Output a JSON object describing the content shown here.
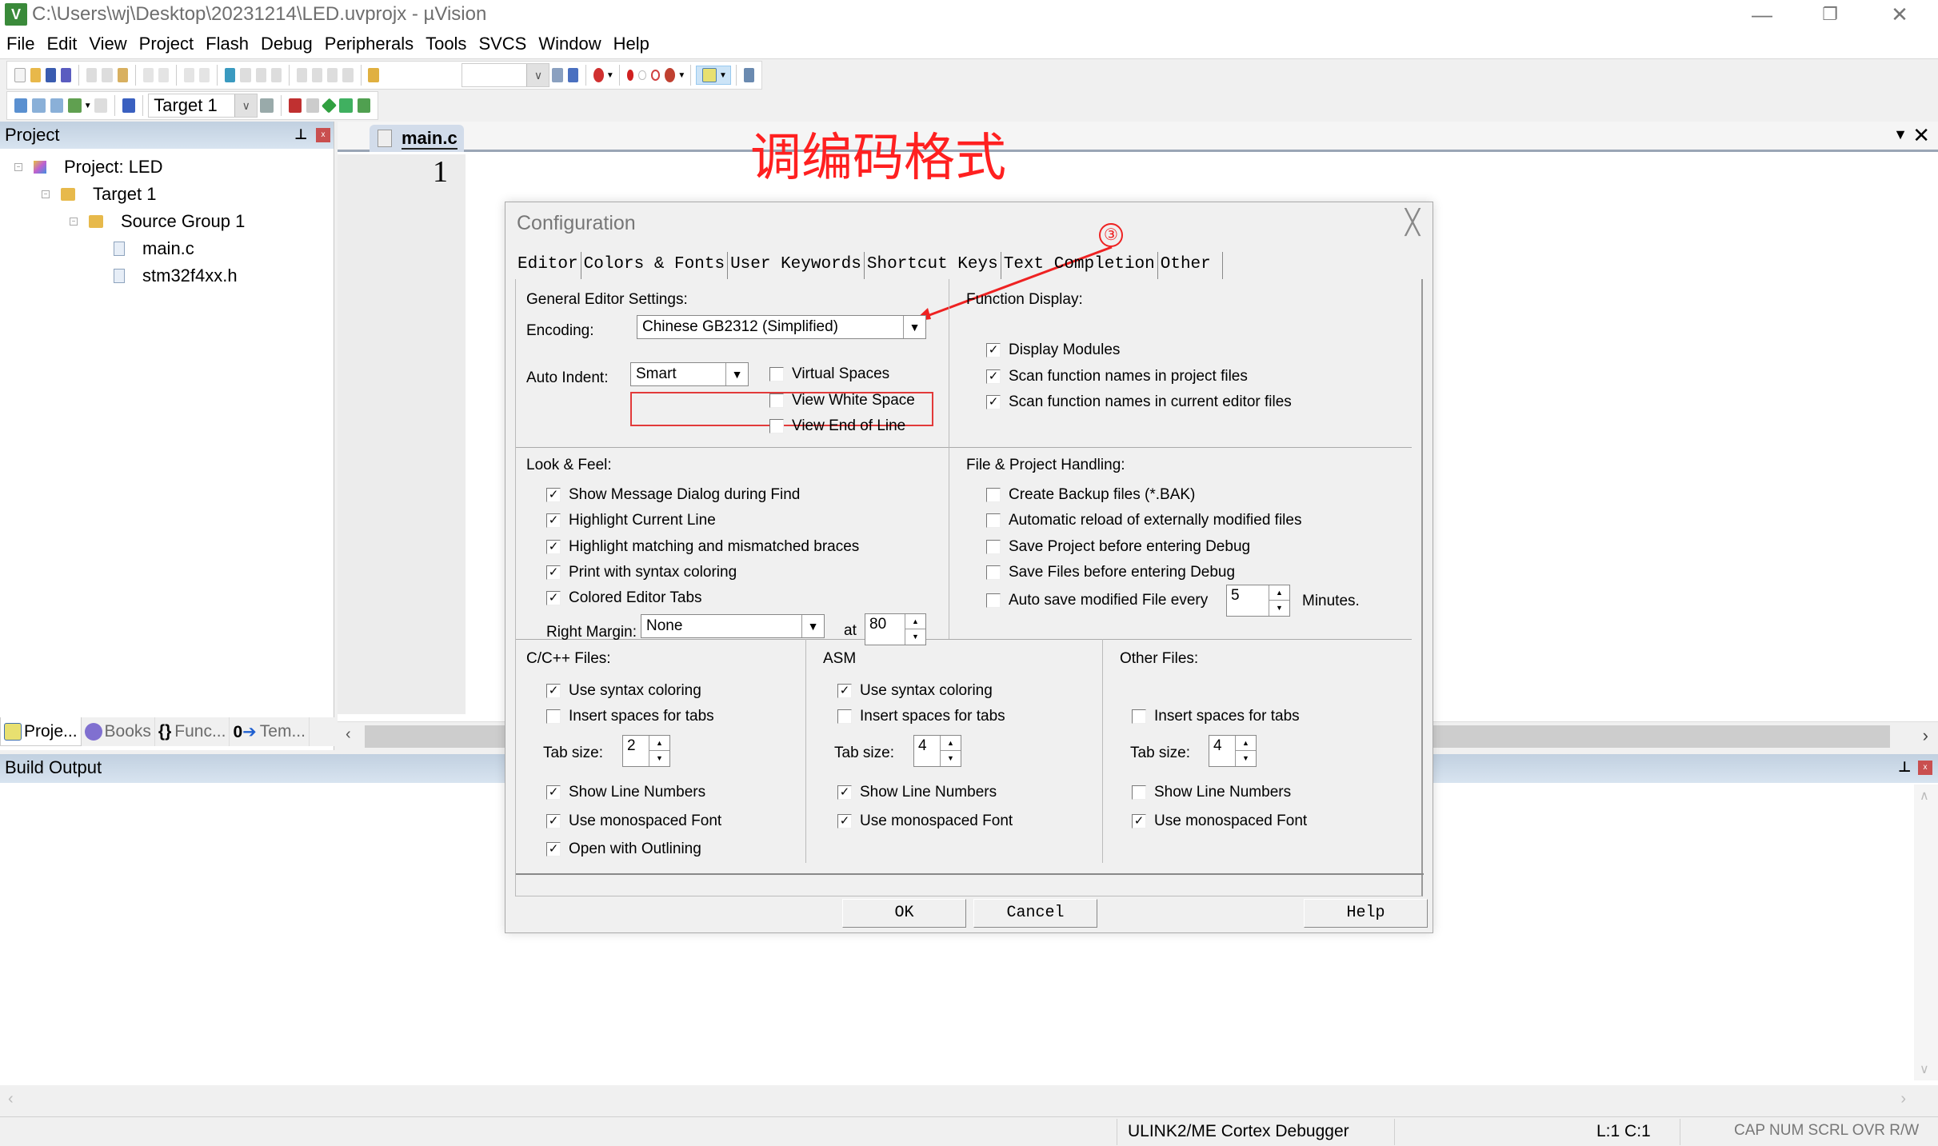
{
  "window": {
    "title": "C:\\Users\\wj\\Desktop\\20231214\\LED.uvprojx - µVision",
    "app_icon": "uvision-logo-icon",
    "controls": {
      "minimize": "—",
      "restore": "❐",
      "close": "✕"
    }
  },
  "menu": [
    "File",
    "Edit",
    "View",
    "Project",
    "Flash",
    "Debug",
    "Peripherals",
    "Tools",
    "SVCS",
    "Window",
    "Help"
  ],
  "toolbar2": {
    "target_select": "Target 1"
  },
  "project_panel": {
    "title": "Project",
    "tree": [
      {
        "label": "Project: LED",
        "level": 0,
        "icon": "project-icon"
      },
      {
        "label": "Target 1",
        "level": 1,
        "icon": "target-folder-icon"
      },
      {
        "label": "Source Group 1",
        "level": 2,
        "icon": "folder-icon"
      },
      {
        "label": "main.c",
        "level": 3,
        "icon": "file-icon"
      },
      {
        "label": "stm32f4xx.h",
        "level": 3,
        "icon": "file-icon"
      }
    ],
    "tabs": [
      "Proje...",
      "Books",
      "Func...",
      "Tem..."
    ]
  },
  "editor": {
    "tab": "main.c",
    "line_numbers": [
      "1"
    ]
  },
  "annotation": {
    "text": "调编码格式",
    "step_marker": "③",
    "color": "#ff2020"
  },
  "dialog": {
    "title": "Configuration",
    "tabs": [
      "Editor",
      "Colors & Fonts",
      "User Keywords",
      "Shortcut Keys",
      "Text Completion",
      "Other"
    ],
    "active_tab": "Editor",
    "general": {
      "heading": "General Editor Settings:",
      "encoding_label": "Encoding:",
      "encoding_value": "Chinese GB2312 (Simplified)",
      "auto_indent_label": "Auto Indent:",
      "auto_indent_value": "Smart",
      "checks": [
        {
          "label": "Virtual Spaces",
          "checked": false
        },
        {
          "label": "View White Space",
          "checked": false
        },
        {
          "label": "View End of Line",
          "checked": false
        }
      ]
    },
    "function_display": {
      "heading": "Function Display:",
      "checks": [
        {
          "label": "Display Modules",
          "checked": true
        },
        {
          "label": "Scan function names in project files",
          "checked": true
        },
        {
          "label": "Scan function names in current editor files",
          "checked": true
        }
      ]
    },
    "look_feel": {
      "heading": "Look & Feel:",
      "checks": [
        {
          "label": "Show Message Dialog during Find",
          "checked": true
        },
        {
          "label": "Highlight Current Line",
          "checked": true
        },
        {
          "label": "Highlight matching and mismatched braces",
          "checked": true
        },
        {
          "label": "Print with syntax coloring",
          "checked": true
        },
        {
          "label": "Colored Editor Tabs",
          "checked": true
        }
      ],
      "right_margin_label": "Right Margin:",
      "right_margin_value": "None",
      "at_label": "at",
      "at_value": "80"
    },
    "file_project": {
      "heading": "File & Project Handling:",
      "checks": [
        {
          "label": "Create Backup files (*.BAK)",
          "checked": false
        },
        {
          "label": "Automatic reload of externally modified files",
          "checked": false
        },
        {
          "label": "Save Project before entering Debug",
          "checked": false
        },
        {
          "label": "Save Files before entering Debug",
          "checked": false
        },
        {
          "label": "Auto save modified File every",
          "checked": false
        }
      ],
      "autosave_minutes": "5",
      "minutes_label": "Minutes."
    },
    "cpp": {
      "heading": "C/C++ Files:",
      "syntax": {
        "label": "Use syntax coloring",
        "checked": true
      },
      "spaces": {
        "label": "Insert spaces for tabs",
        "checked": false
      },
      "tab_size_label": "Tab size:",
      "tab_size": "2",
      "line_numbers": {
        "label": "Show Line Numbers",
        "checked": true
      },
      "mono": {
        "label": "Use monospaced Font",
        "checked": true
      },
      "outlining": {
        "label": "Open with Outlining",
        "checked": true
      }
    },
    "asm": {
      "heading": "ASM",
      "syntax": {
        "label": "Use syntax coloring",
        "checked": true
      },
      "spaces": {
        "label": "Insert spaces for tabs",
        "checked": false
      },
      "tab_size_label": "Tab size:",
      "tab_size": "4",
      "line_numbers": {
        "label": "Show Line Numbers",
        "checked": true
      },
      "mono": {
        "label": "Use monospaced Font",
        "checked": true
      }
    },
    "other": {
      "heading": "Other Files:",
      "spaces": {
        "label": "Insert spaces for tabs",
        "checked": false
      },
      "tab_size_label": "Tab size:",
      "tab_size": "4",
      "line_numbers": {
        "label": "Show Line Numbers",
        "checked": false
      },
      "mono": {
        "label": "Use monospaced Font",
        "checked": true
      }
    },
    "buttons": {
      "ok": "OK",
      "cancel": "Cancel",
      "help": "Help"
    }
  },
  "build_output": {
    "title": "Build Output"
  },
  "statusbar": {
    "debugger": "ULINK2/ME Cortex Debugger",
    "position": "L:1 C:1",
    "indicators": "CAP NUM SCRL OVR R/W"
  }
}
